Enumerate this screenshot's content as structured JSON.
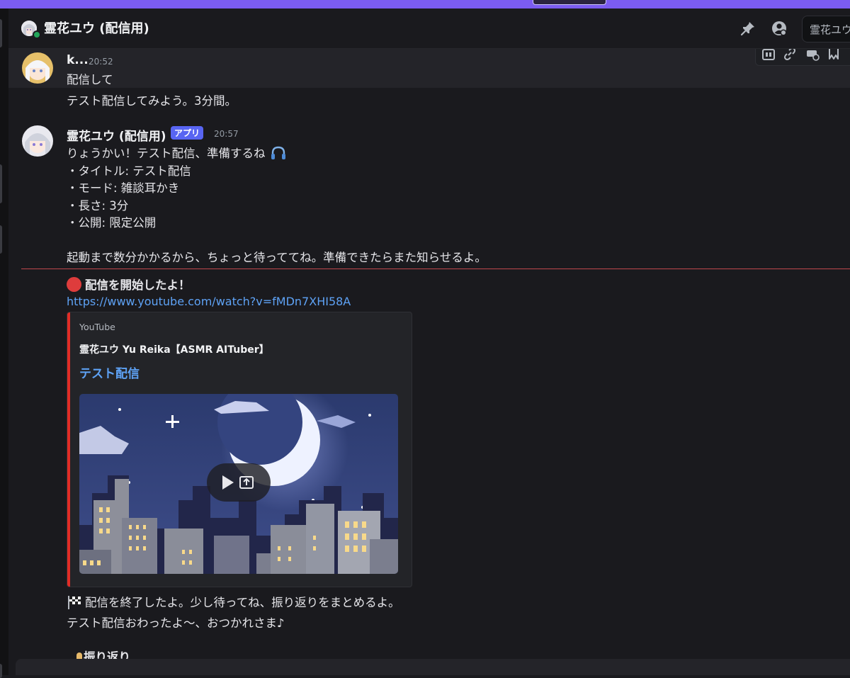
{
  "header": {
    "title": "霊花ユウ (配信用)",
    "search_placeholder": "霊花ユウ"
  },
  "messages": [
    {
      "author": "k...",
      "time": "20:52",
      "lines": [
        "配信して",
        "テスト配信してみよう。3分間。"
      ]
    },
    {
      "author": "霊花ユウ (配信用)",
      "badge": "アプリ",
      "time": "20:57",
      "lines": [
        "りょうかい！テスト配信、準備するね",
        "・タイトル: テスト配信",
        "・モード: 雑談耳かき",
        "・長さ: 3分",
        "・公開: 限定公開",
        "起動まで数分かかるから、ちょっと待っててね。準備できたらまた知らせるよ。"
      ],
      "stream_start": "配信を開始したよ！",
      "link": "https://www.youtube.com/watch?v=fMDn7XHI58A",
      "embed": {
        "provider": "YouTube",
        "author": "霊花ユウ Yu Reika【ASMR AITuber】",
        "title": "テスト配信"
      },
      "after_lines": [
        "配信を終了したよ。少し待ってね、振り返りをまとめるよ。",
        "テスト配信おわったよ〜、おつかれさま♪",
        "振り返り"
      ]
    }
  ],
  "colors": {
    "accent_bar": "#7b5cf0",
    "app_badge": "#5865f2",
    "link": "#5ea2f5",
    "new_message_line": "#c0474d",
    "embed_bar": "#e22c26"
  }
}
